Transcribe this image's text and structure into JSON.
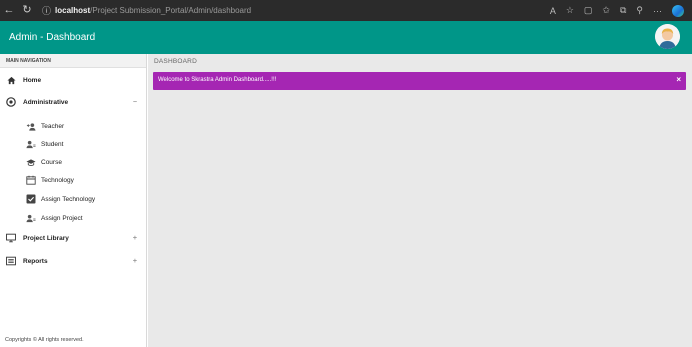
{
  "browser": {
    "back_icon": "arrow-left-icon",
    "refresh_icon": "refresh-icon",
    "host": "localhost",
    "path": "/Project Submission_Portal/Admin/dashboard",
    "toolbar_icons": [
      "read-aloud-icon",
      "favorite-icon",
      "split-screen-icon",
      "favorites-bar-icon",
      "collections-icon",
      "extensions-icon",
      "more-icon",
      "edge-logo-icon"
    ]
  },
  "app": {
    "title": "Admin - Dashboard",
    "accent": "#009688"
  },
  "sidebar": {
    "header": "MAIN NAVIGATION",
    "items": [
      {
        "label": "Home",
        "icon": "home-icon",
        "level": "main",
        "toggle": ""
      },
      {
        "label": "Administrative",
        "icon": "settings-icon",
        "level": "main",
        "toggle": "−"
      },
      {
        "label": "Teacher",
        "icon": "add-user-icon",
        "level": "sub",
        "toggle": ""
      },
      {
        "label": "Student",
        "icon": "users-icon",
        "level": "sub",
        "toggle": ""
      },
      {
        "label": "Course",
        "icon": "graduation-cap-icon",
        "level": "sub",
        "toggle": ""
      },
      {
        "label": "Technology",
        "icon": "calendar-icon",
        "level": "sub",
        "toggle": ""
      },
      {
        "label": "Assign Technology",
        "icon": "check-square-icon",
        "level": "sub",
        "toggle": ""
      },
      {
        "label": "Assign Project",
        "icon": "users-icon",
        "level": "sub",
        "toggle": ""
      },
      {
        "label": "Project Library",
        "icon": "monitor-icon",
        "level": "main",
        "toggle": "+"
      },
      {
        "label": "Reports",
        "icon": "list-icon",
        "level": "main",
        "toggle": "+"
      }
    ],
    "copyright": "Copyrights © All rights reserved."
  },
  "main": {
    "page_title": "DASHBOARD",
    "alert": {
      "message": "Welcome to Skrastra Admin Dashboard.....!!!",
      "close": "×",
      "color": "#a526b3"
    }
  }
}
